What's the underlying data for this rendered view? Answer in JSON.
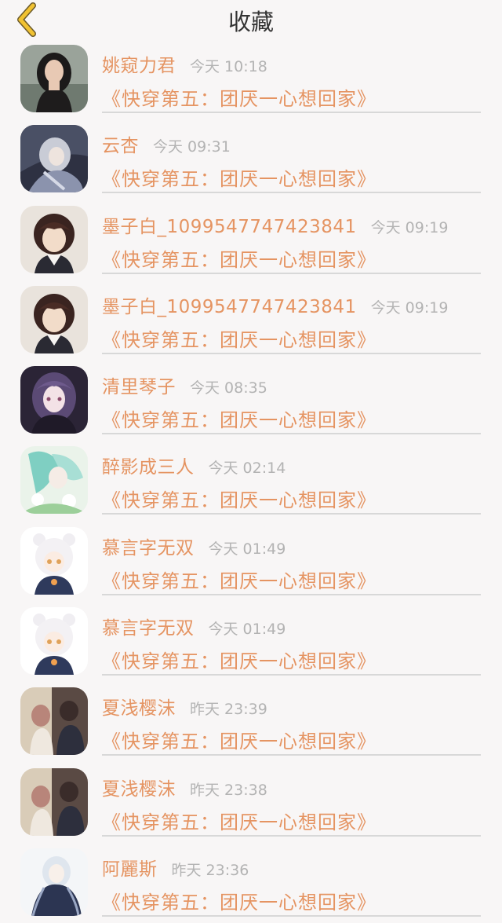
{
  "header": {
    "title": "收藏",
    "back_icon": "chevron-left-icon",
    "back_color": "#f1c232"
  },
  "colors": {
    "accent": "#e59462",
    "time": "#b3b3b3",
    "divider": "#d8d8d8",
    "background": "#f8f6f6"
  },
  "items": [
    {
      "name": "姚窥力君",
      "time": "今天 10:18",
      "book": "《快穿第五：团厌一心想回家》"
    },
    {
      "name": "云杏",
      "time": "今天 09:31",
      "book": "《快穿第五：团厌一心想回家》"
    },
    {
      "name": "墨子白_1099547747423841",
      "time": "今天 09:19",
      "book": "《快穿第五：团厌一心想回家》"
    },
    {
      "name": "墨子白_1099547747423841",
      "time": "今天 09:19",
      "book": "《快穿第五：团厌一心想回家》"
    },
    {
      "name": "清里琴子",
      "time": "今天 08:35",
      "book": "《快穿第五：团厌一心想回家》"
    },
    {
      "name": "醉影成三人",
      "time": "今天 02:14",
      "book": "《快穿第五：团厌一心想回家》"
    },
    {
      "name": "慕言字无双",
      "time": "今天 01:49",
      "book": "《快穿第五：团厌一心想回家》"
    },
    {
      "name": "慕言字无双",
      "time": "今天 01:49",
      "book": "《快穿第五：团厌一心想回家》"
    },
    {
      "name": "夏浅樱沫",
      "time": "昨天 23:39",
      "book": "《快穿第五：团厌一心想回家》"
    },
    {
      "name": "夏浅樱沫",
      "time": "昨天 23:38",
      "book": "《快穿第五：团厌一心想回家》"
    },
    {
      "name": "阿麗斯",
      "time": "昨天 23:36",
      "book": "《快穿第五：团厌一心想回家》"
    }
  ]
}
